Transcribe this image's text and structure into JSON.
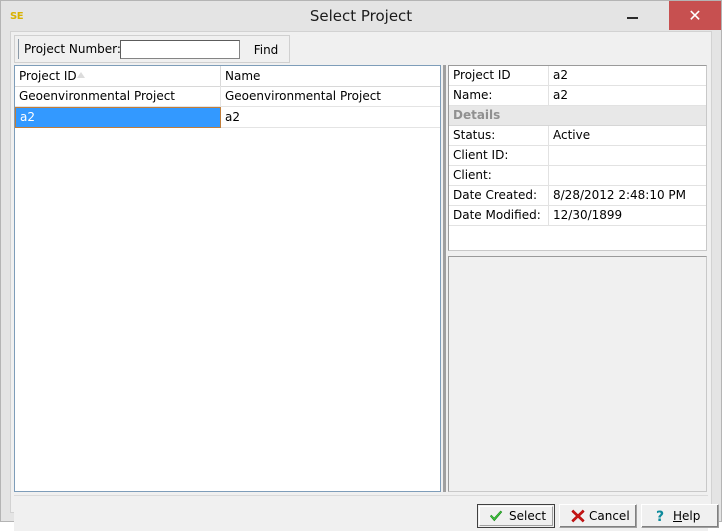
{
  "window": {
    "title": "Select Project",
    "icon_label": "SE",
    "icon_name": "app-icon-se",
    "controls": {
      "minimize": "minimize-icon",
      "maximize": "maximize-icon",
      "close": "close-icon",
      "close_glyph": "✕"
    }
  },
  "toolbar": {
    "project_number_label": "Project Number:",
    "project_number_value": "",
    "project_number_placeholder": "",
    "find_label": "Find"
  },
  "list": {
    "columns": [
      {
        "label": "Project ID",
        "sort": "ascending"
      },
      {
        "label": "Name",
        "sort": "none"
      }
    ],
    "rows": [
      {
        "project_id": "Geoenvironmental Project",
        "name": "Geoenvironmental Project",
        "selected": false
      },
      {
        "project_id": "a2",
        "name": "a2",
        "selected": true
      }
    ]
  },
  "details": {
    "rows": [
      {
        "type": "field",
        "label": "Project ID",
        "value": "a2"
      },
      {
        "type": "field",
        "label": "Name:",
        "value": "a2"
      },
      {
        "type": "category",
        "label": "Details",
        "value": ""
      },
      {
        "type": "field",
        "label": "Status:",
        "value": "Active"
      },
      {
        "type": "field",
        "label": "Client ID:",
        "value": ""
      },
      {
        "type": "field",
        "label": "Client:",
        "value": ""
      },
      {
        "type": "field",
        "label": "Date Created:",
        "value": "8/28/2012 2:48:10 PM"
      },
      {
        "type": "field",
        "label": "Date Modified:",
        "value": "12/30/1899"
      }
    ]
  },
  "description_panel": {
    "content": ""
  },
  "buttons": {
    "select": {
      "label": "Select",
      "icon": "green-check-icon",
      "default": true
    },
    "cancel": {
      "label": "Cancel",
      "icon": "red-x-icon",
      "default": false
    },
    "help": {
      "label_prefix": "H",
      "label_rest": "elp",
      "icon": "question-mark-icon",
      "default": false
    }
  },
  "colors": {
    "selection_blue": "#3399ff",
    "selection_border": "#c07d3a",
    "close_button_red": "#c75050",
    "icon_yellow": "#d8b200",
    "check_green": "#108010",
    "x_red": "#c00000",
    "help_teal": "#0d8a9c",
    "category_gray": "#909090"
  }
}
